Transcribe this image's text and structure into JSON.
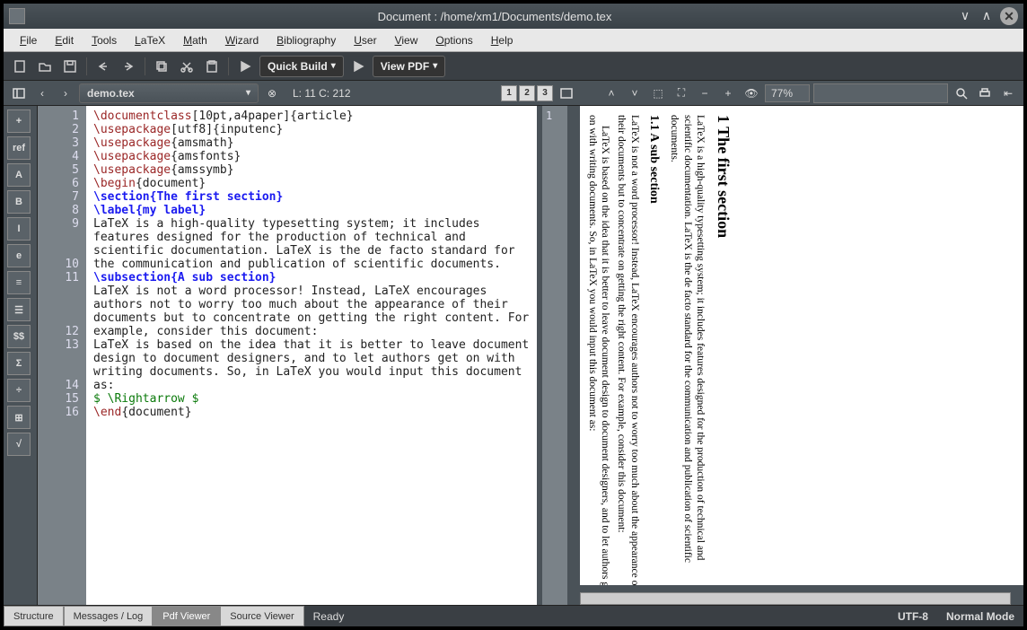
{
  "title": "Document : /home/xm1/Documents/demo.tex",
  "menu": [
    "File",
    "Edit",
    "Tools",
    "LaTeX",
    "Math",
    "Wizard",
    "Bibliography",
    "User",
    "View",
    "Options",
    "Help"
  ],
  "toolbar": {
    "quick_build": "Quick Build",
    "view_pdf": "View PDF"
  },
  "doc_tab": "demo.tex",
  "cursor": "L: 11 C: 212",
  "pages": [
    "1",
    "2",
    "3"
  ],
  "zoom": "77%",
  "left_icons": [
    "+",
    "ref",
    "A",
    "B",
    "I",
    "e",
    "≡",
    "☰",
    "$$",
    "Σ",
    "÷",
    "⊞",
    "√"
  ],
  "gutter_lines": [
    "1",
    "2",
    "3",
    "4",
    "5",
    "6",
    "7",
    "8",
    "9",
    "",
    "",
    "10",
    "11",
    "",
    "",
    "",
    "12",
    "13",
    "",
    "",
    "14",
    "15",
    "16"
  ],
  "right_gutter_line": "1",
  "code_lines": [
    {
      "t": "cmd",
      "parts": [
        {
          "c": "kw",
          "v": "\\documentclass"
        },
        {
          "c": "",
          "v": "[10pt,a4paper]{article}"
        }
      ]
    },
    {
      "t": "cmd",
      "parts": [
        {
          "c": "kw",
          "v": "\\usepackage"
        },
        {
          "c": "",
          "v": "[utf8]{inputenc}"
        }
      ]
    },
    {
      "t": "cmd",
      "parts": [
        {
          "c": "kw",
          "v": "\\usepackage"
        },
        {
          "c": "",
          "v": "{amsmath}"
        }
      ]
    },
    {
      "t": "cmd",
      "parts": [
        {
          "c": "kw",
          "v": "\\usepackage"
        },
        {
          "c": "",
          "v": "{amsfonts}"
        }
      ]
    },
    {
      "t": "cmd",
      "parts": [
        {
          "c": "kw",
          "v": "\\usepackage"
        },
        {
          "c": "",
          "v": "{amssymb}"
        }
      ]
    },
    {
      "t": "cmd",
      "parts": [
        {
          "c": "kw",
          "v": "\\begin"
        },
        {
          "c": "",
          "v": "{document}"
        }
      ]
    },
    {
      "t": "cmd",
      "parts": [
        {
          "c": "kw2",
          "v": "\\section{The first section}"
        }
      ]
    },
    {
      "t": "cmd",
      "parts": [
        {
          "c": "kw2",
          "v": "\\label{my label}"
        }
      ]
    },
    {
      "t": "text",
      "v": "LaTeX is a high-quality typesetting system; it includes features designed for the production of technical and scientific documentation. LaTeX is the de facto standard for the communication and publication of scientific documents."
    },
    {
      "t": "cmd",
      "parts": [
        {
          "c": "kw2",
          "v": "\\subsection{A sub section}"
        }
      ]
    },
    {
      "t": "text",
      "v": "LaTeX is not a word processor! Instead, LaTeX encourages authors not to worry too much about the appearance of their documents but to concentrate on getting the right content. For example, consider this document:"
    },
    {
      "t": "text",
      "v": ""
    },
    {
      "t": "text",
      "v": "LaTeX is based on the idea that it is better to leave document design to document designers, and to let authors get on with writing documents. So, in LaTeX you would input this document as:"
    },
    {
      "t": "cmd",
      "parts": [
        {
          "c": "math",
          "v": "$ \\Rightarrow $"
        }
      ]
    },
    {
      "t": "cmd",
      "parts": [
        {
          "c": "kw",
          "v": "\\end"
        },
        {
          "c": "",
          "v": "{document}"
        }
      ]
    },
    {
      "t": "text",
      "v": ""
    }
  ],
  "preview": {
    "h1": "1   The first section",
    "p1": "LaTeX is a high-quality typesetting system; it includes features designed for the production of technical and scientific documentation. LaTeX is the de facto standard for the communication and publication of scientific documents.",
    "h2": "1.1   A sub section",
    "p2": "LaTeX is not a word processor! Instead, LaTeX encourages authors not to worry too much about the appearance of their documents but to concentrate on getting the right content. For example, consider this document:",
    "p3": "LaTeX is based on the idea that it is better to leave document design to document designers, and to let authors get on with writing documents. So, in LaTeX you would input this document as:"
  },
  "status": {
    "tabs": [
      "Structure",
      "Messages / Log",
      "Pdf Viewer",
      "Source Viewer"
    ],
    "ready": "Ready",
    "encoding": "UTF-8",
    "mode": "Normal Mode"
  }
}
